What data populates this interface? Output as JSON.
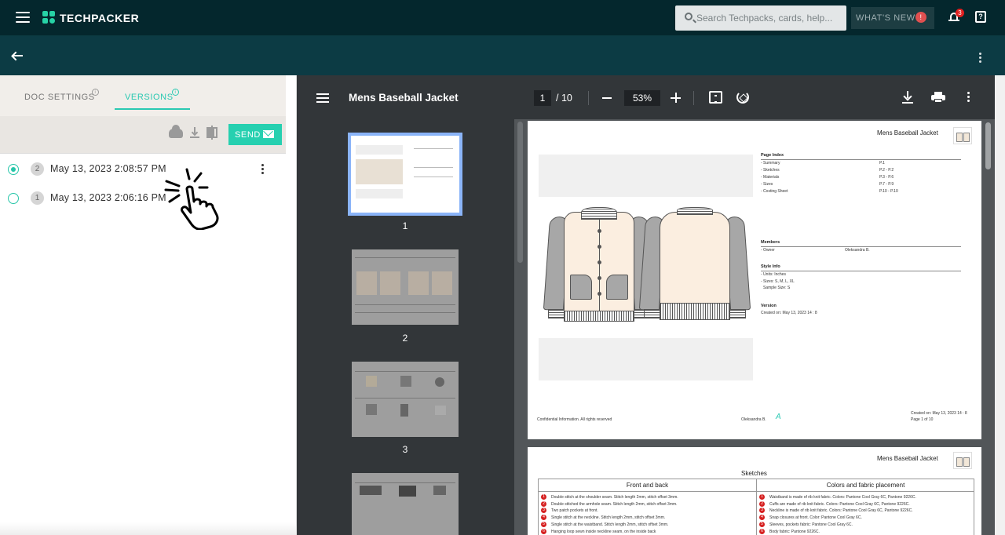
{
  "app": {
    "name": "TECHPACKER",
    "search_placeholder": "Search Techpacks, cards, help...",
    "whats_new_label": "WHAT'S NEW",
    "whats_new_badge": "!",
    "notification_count": "3",
    "help_glyph": "?"
  },
  "left_panel": {
    "tabs": [
      {
        "label": "DOC SETTINGS",
        "info": "i"
      },
      {
        "label": "VERSIONS",
        "info": "i"
      }
    ],
    "send_label": "SEND",
    "versions": [
      {
        "number": "2",
        "date": "May 13, 2023 2:08:57 PM",
        "selected": true
      },
      {
        "number": "1",
        "date": "May 13, 2023 2:06:16 PM",
        "selected": false
      }
    ]
  },
  "viewer": {
    "title": "Mens Baseball Jacket",
    "current_page": "1",
    "total_pages": "/ 10",
    "zoom": "53%",
    "thumbnails": [
      "1",
      "2",
      "3"
    ]
  },
  "page1": {
    "title": "Mens Baseball Jacket",
    "page_index_heading": "Page Index",
    "page_index": [
      {
        "name": "- Summary",
        "page": "P.1"
      },
      {
        "name": "- Sketches",
        "page": "P.2 - P.2"
      },
      {
        "name": "- Materials",
        "page": "P.3 - P.6"
      },
      {
        "name": "- Sizes",
        "page": "P.7 - P.9"
      },
      {
        "name": "- Costing Sheet",
        "page": "P.10 - P.10"
      }
    ],
    "members_heading": "Members",
    "members": [
      {
        "role": "- Owner",
        "name": "Oleksandra B."
      }
    ],
    "style_info_heading": "Style Info",
    "style_info": [
      "- Units: Inches",
      "- Sizes: S, M, L, XL",
      "  Sample Size: S"
    ],
    "version_heading": "Version",
    "version_created": "Created on: May 13, 2023 14 : 8",
    "footer_confidential": "Confidential Information. All rights reserved",
    "footer_author": "Oleksandra B.",
    "footer_created": "Created on: May 13, 2023 14 : 8",
    "footer_page": "Page 1 of 10",
    "signature": "A"
  },
  "page2": {
    "title": "Mens Baseball Jacket",
    "section_title": "Sketches",
    "left_column_title": "Front and back",
    "right_column_title": "Colors and fabric placement",
    "left_items": [
      {
        "n": "1",
        "text": "Double stitch at the shoulder seam. Stitch length 2mm, stitch offset 3mm."
      },
      {
        "n": "2",
        "text": "Double stitched the armhole seam. Stitch length 2mm, stitch offset 3mm."
      },
      {
        "n": "3",
        "text": "Two patch pockets at front."
      },
      {
        "n": "4",
        "text": "Single stitch at the neckline. Stitch length 2mm, stitch offset 3mm."
      },
      {
        "n": "5",
        "text": "Single stitch at the waistband. Stitch length 2mm, stitch offset 3mm."
      },
      {
        "n": "6",
        "text": "Hanging loop sewn inside neckline seam, on the inside back"
      }
    ],
    "right_items": [
      {
        "n": "1",
        "text": "Waistband is made of rib knit fabric. Colors: Pantone Cool Gray 6C, Pantone 9226C."
      },
      {
        "n": "2",
        "text": "Cuffs are made of rib knit fabric. Colors: Pantone Cool Gray 6C, Pantone 9226C."
      },
      {
        "n": "3",
        "text": "Neckline is made of rib knit fabric. Colors: Pantone Cool Gray 6C, Pantone 9226C."
      },
      {
        "n": "4",
        "text": "Snap closures at front. Color: Pantone Cool Gray 6C."
      },
      {
        "n": "5",
        "text": "Sleeves, pockets fabric: Pantone Cool Gray 6C."
      },
      {
        "n": "6",
        "text": "Body fabric: Pantone 9226C."
      }
    ]
  },
  "colors": {
    "topbar": "#04272d",
    "subbar": "#0c3b44",
    "accent": "#26d0b0",
    "viewer_bg": "#525659",
    "viewer_toolbar": "#323639"
  },
  "icons": [
    "menu-icon",
    "search-icon",
    "bell-icon",
    "help-icon",
    "back-arrow-icon",
    "cloud-upload-icon",
    "download-icon",
    "compare-icon",
    "mail-icon",
    "more-vert-icon",
    "zoom-out-icon",
    "zoom-in-icon",
    "fit-page-icon",
    "rotate-icon",
    "print-icon",
    "hand-pointer-icon"
  ]
}
